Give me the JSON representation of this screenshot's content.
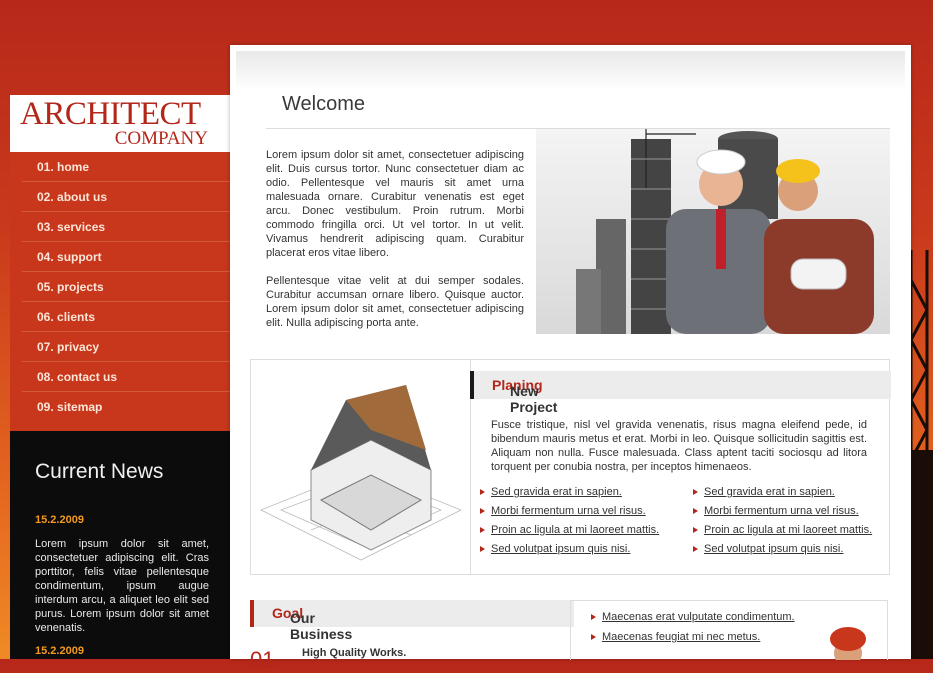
{
  "logo": {
    "line1": "ARCHITECT",
    "line2": "COMPANY"
  },
  "nav": [
    {
      "label": "01.  home"
    },
    {
      "label": "02.  about us"
    },
    {
      "label": "03.  services"
    },
    {
      "label": "04.  support"
    },
    {
      "label": "05.  projects"
    },
    {
      "label": "06.  clients"
    },
    {
      "label": "07.  privacy"
    },
    {
      "label": "08.  contact us"
    },
    {
      "label": "09.  sitemap"
    }
  ],
  "news": {
    "title": "Current News",
    "items": [
      {
        "date": "15.2.2009",
        "text": "Lorem ipsum dolor sit amet, consectetuer adipiscing elit. Cras porttitor, felis vitae pellentesque condimentum, ipsum augue interdum arcu, a aliquet leo elit sed purus. Lorem ipsum dolor sit amet venenatis."
      },
      {
        "date": "15.2.2009"
      }
    ]
  },
  "welcome": {
    "title": "Welcome",
    "p1": "Lorem ipsum dolor sit amet, consectetuer adipiscing elit. Duis cursus tortor. Nunc consectetuer diam ac odio. Pellentesque vel mauris sit amet urna malesuada ornare. Curabitur venenatis est eget arcu. Donec vestibulum. Proin rutrum. Morbi commodo fringilla orci. Ut vel tortor. In ut velit. Vivamus hendrerit adipiscing quam. Curabitur placerat eros vitae libero.",
    "p2": "Pellentesque vitae velit at dui semper sodales. Curabitur accumsan ornare libero. Quisque auctor. Lorem ipsum dolor sit amet, consectetuer adipiscing elit. Nulla adipiscing porta ante."
  },
  "project": {
    "title": "New Project ",
    "title_accent": "Planing",
    "text": "Fusce tristique, nisl vel gravida venenatis, risus magna eleifend pede, id bibendum mauris metus et erat. Morbi in leo. Quisque sollicitudin sagittis est. Aliquam non nulla. Fusce malesuada. Class aptent taciti sociosqu ad litora torquent per conubia nostra, per inceptos himenaeos.",
    "links_left": [
      "Sed gravida erat in sapien.",
      "Morbi fermentum urna vel risus.",
      "Proin ac ligula at mi laoreet mattis.",
      "Sed volutpat ipsum quis nisi."
    ],
    "links_right": [
      "Sed gravida erat in sapien.",
      "Morbi fermentum urna vel risus.",
      "Proin ac ligula at mi laoreet mattis.",
      "Sed volutpat ipsum quis nisi."
    ]
  },
  "goal": {
    "title": "Our Business ",
    "title_accent": "Goal",
    "number": "01",
    "item": "High Quality Works.",
    "links": [
      "Maecenas erat vulputate condimentum.",
      "Maecenas feugiat mi nec metus."
    ]
  },
  "colors": {
    "accent": "#b3271a",
    "nav_bg": "#c8361b",
    "news_bg": "#0c0c0c",
    "date": "#f39a1e"
  }
}
